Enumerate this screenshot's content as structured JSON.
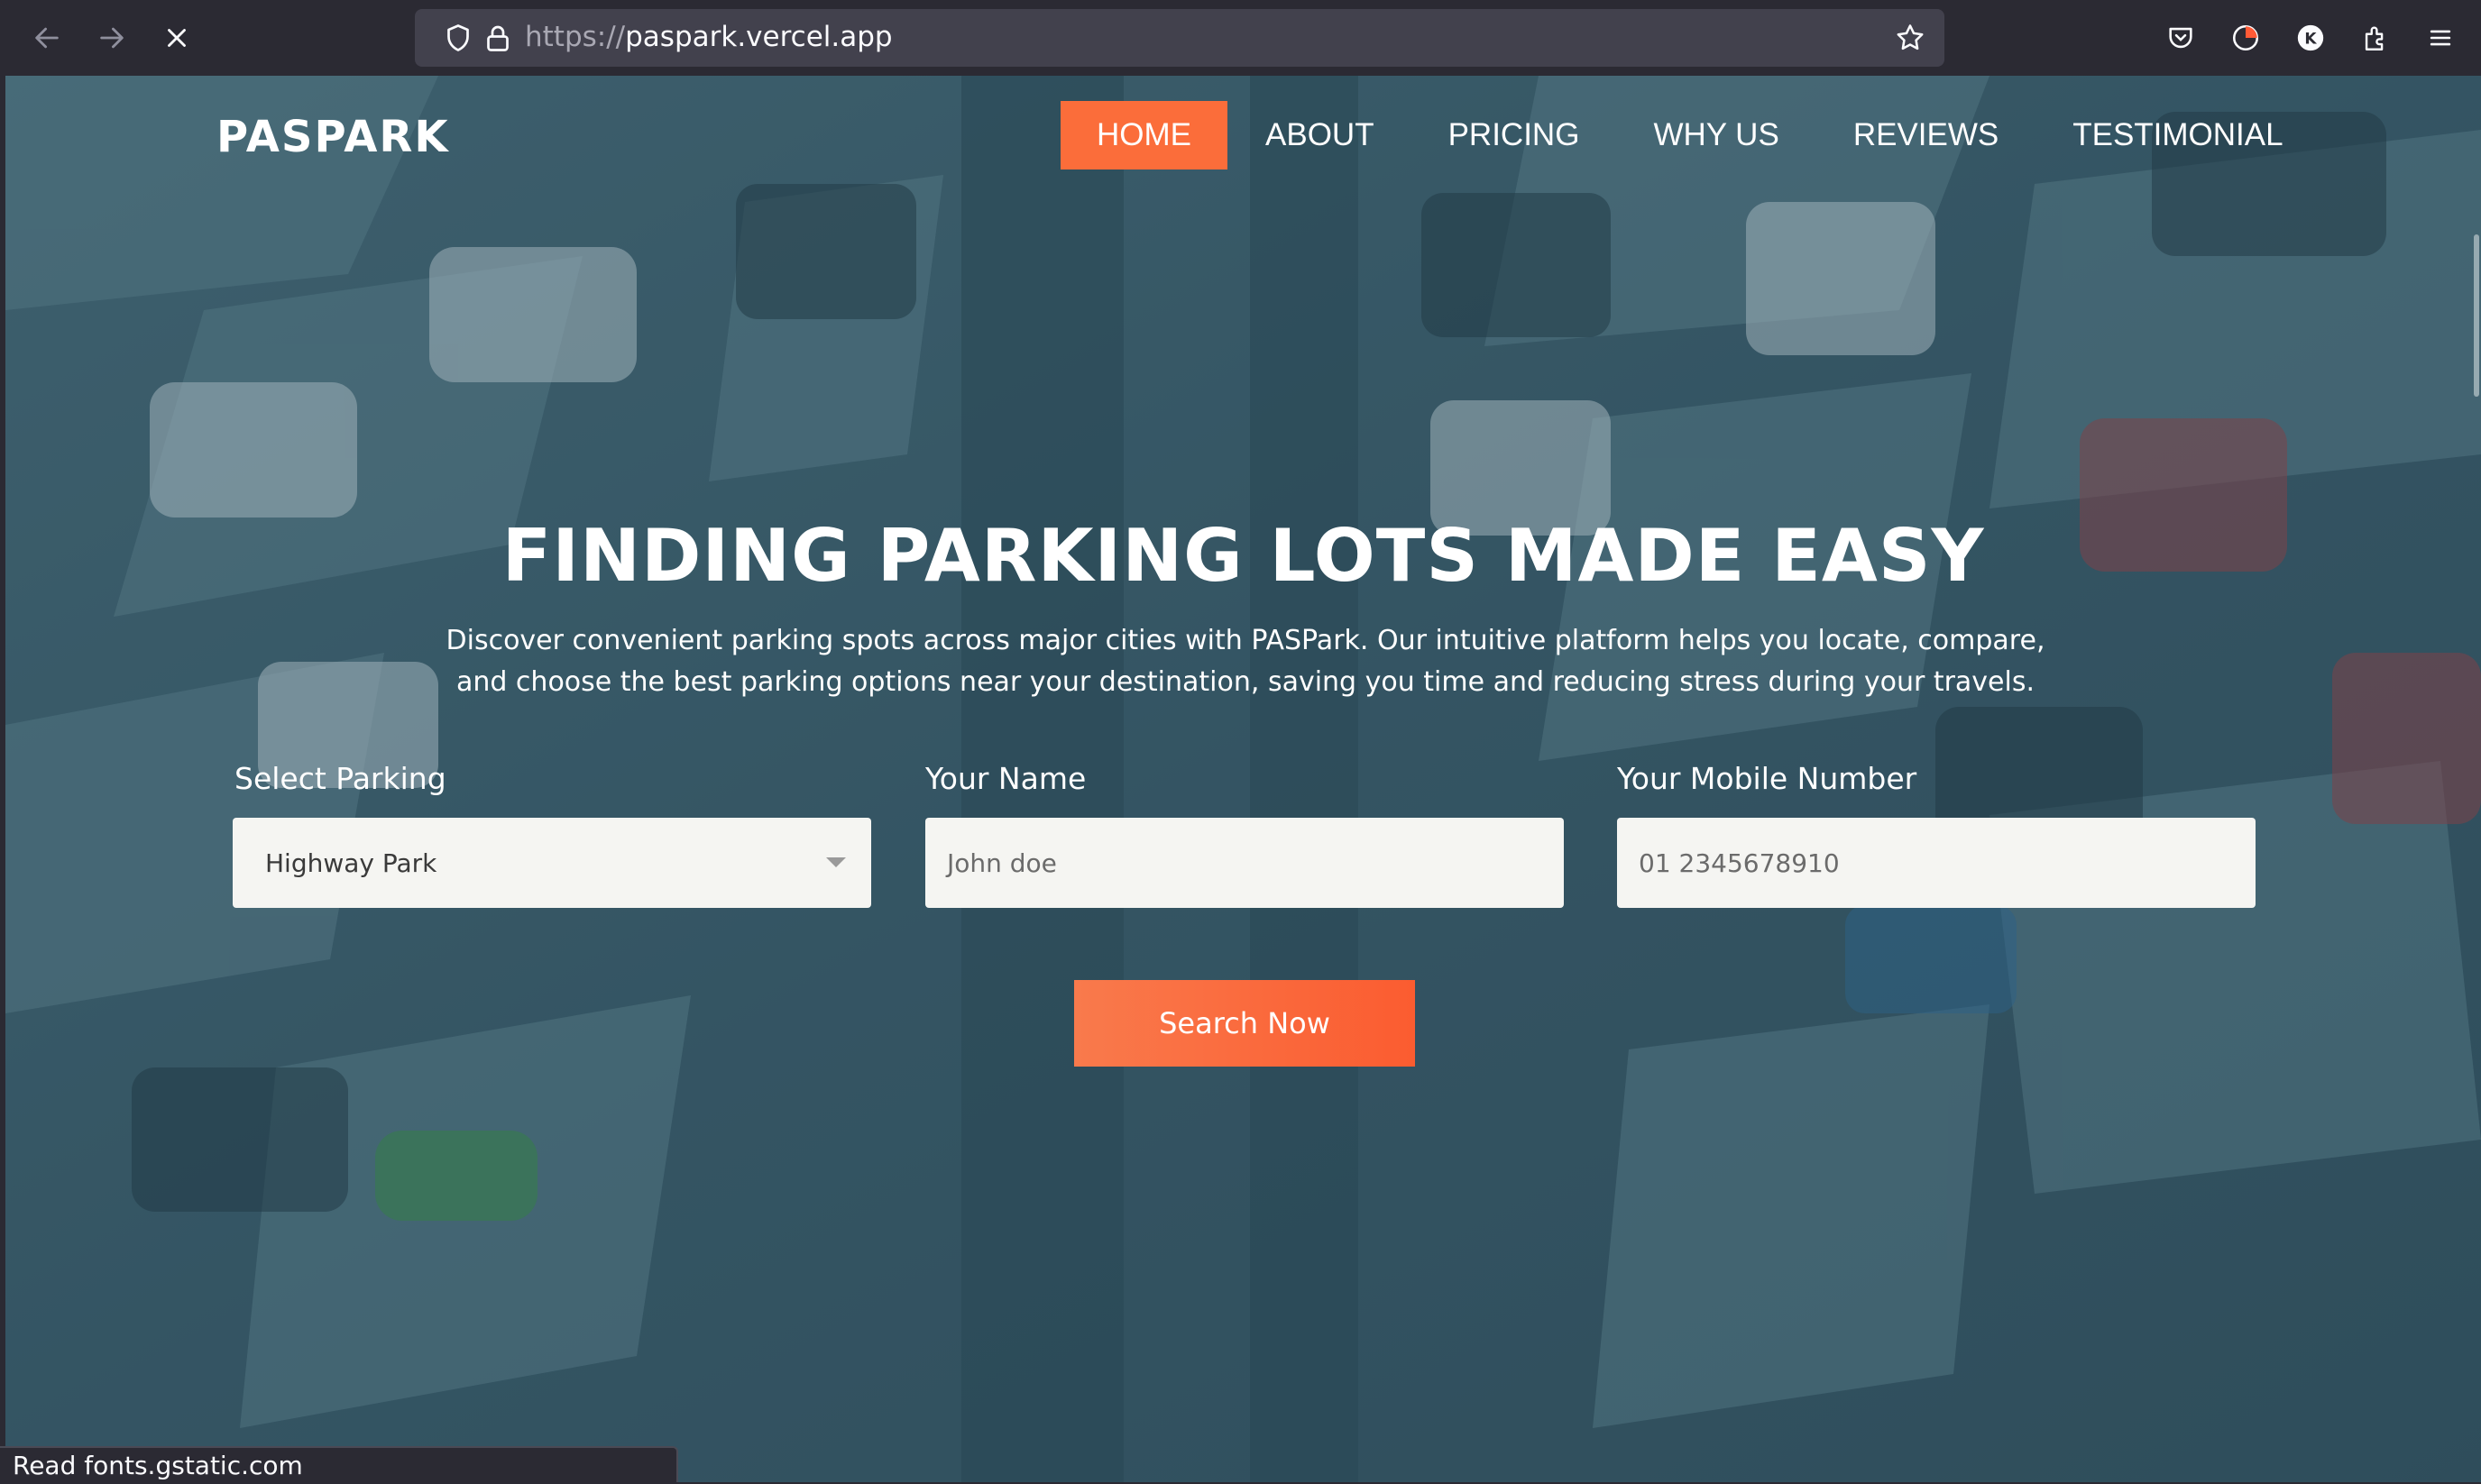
{
  "browser": {
    "url_scheme": "https://",
    "url_host": "paspark.vercel.app",
    "profile_initial": "K",
    "icons": [
      "back-arrow-icon",
      "forward-arrow-icon",
      "stop-loading-icon",
      "shield-icon",
      "lock-icon",
      "star-icon",
      "pocket-icon",
      "account-icon",
      "extensions-icon",
      "menu-icon"
    ]
  },
  "site": {
    "brand": "PASPARK",
    "nav": [
      "HOME",
      "ABOUT",
      "PRICING",
      "WHY US",
      "REVIEWS",
      "TESTIMONIAL"
    ],
    "active_nav": "HOME",
    "accent_color": "#fb6d3a"
  },
  "hero": {
    "title": "FINDING PARKING LOTS MADE EASY",
    "description": "Discover convenient parking spots across major cities with PASPark. Our intuitive platform helps you locate, compare, and choose the best parking options near your destination, saving you time and reducing stress during your travels."
  },
  "form": {
    "parking_label": "Select Parking",
    "parking_value": "Highway Park",
    "name_label": "Your Name",
    "name_placeholder": "John doe",
    "mobile_label": "Your Mobile Number",
    "mobile_placeholder": "01 2345678910",
    "submit_label": "Search Now"
  },
  "status_bar": "Read fonts.gstatic.com"
}
